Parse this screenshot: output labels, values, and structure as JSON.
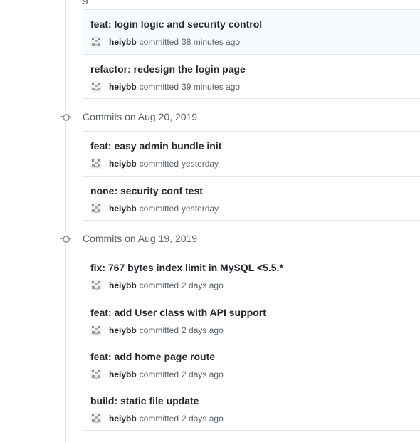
{
  "top_fragment": "g",
  "avatar_icon": "identicon-avatar",
  "groups": [
    {
      "commits": [
        {
          "title": "feat: login logic and security control",
          "author": "heiybb",
          "verb": "committed",
          "time": "38 minutes ago"
        },
        {
          "title": "refactor: redesign the login page",
          "author": "heiybb",
          "verb": "committed",
          "time": "39 minutes ago"
        }
      ]
    },
    {
      "header": "Commits on Aug 20, 2019",
      "commits": [
        {
          "title": "feat: easy admin bundle init",
          "author": "heiybb",
          "verb": "committed",
          "time": "yesterday"
        },
        {
          "title": "none: security conf test",
          "author": "heiybb",
          "verb": "committed",
          "time": "yesterday"
        }
      ]
    },
    {
      "header": "Commits on Aug 19, 2019",
      "commits": [
        {
          "title": "fix: 767 bytes index limit in MySQL <5.5.*",
          "author": "heiybb",
          "verb": "committed",
          "time": "2 days ago"
        },
        {
          "title": "feat: add User class with API support",
          "author": "heiybb",
          "verb": "committed",
          "time": "2 days ago"
        },
        {
          "title": "feat: add home page route",
          "author": "heiybb",
          "verb": "committed",
          "time": "2 days ago"
        },
        {
          "title": "build: static file update",
          "author": "heiybb",
          "verb": "committed",
          "time": "2 days ago"
        }
      ]
    }
  ]
}
